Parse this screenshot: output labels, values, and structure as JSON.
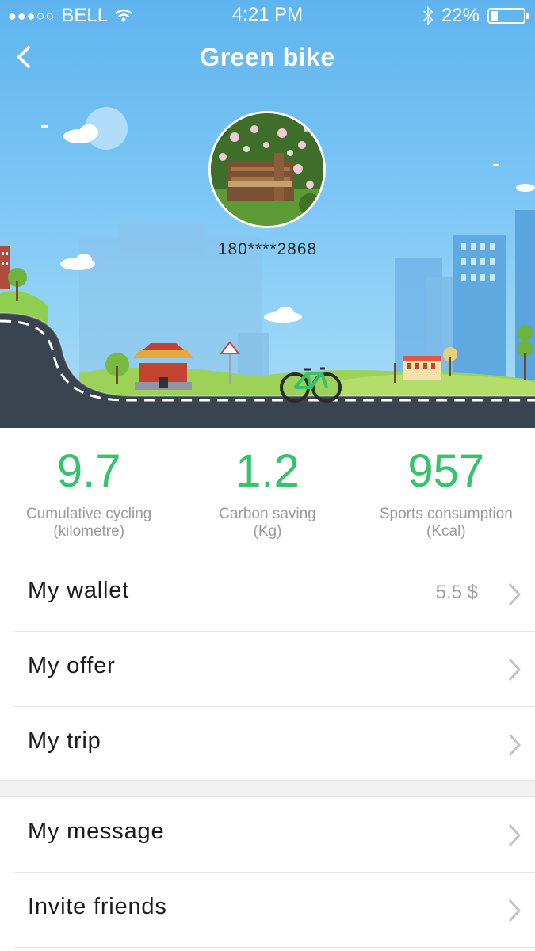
{
  "status_bar": {
    "carrier": "BELL",
    "signal_dots": "●●●○○",
    "time": "4:21 PM",
    "battery": "22%",
    "battery_level": 0.22
  },
  "header": {
    "title": "Green bike"
  },
  "profile": {
    "phone": "180****2868"
  },
  "stats": [
    {
      "value": "9.7",
      "label": "Cumulative cycling",
      "unit": "(kilometre)"
    },
    {
      "value": "1.2",
      "label": "Carbon saving",
      "unit": "(Kg)"
    },
    {
      "value": "957",
      "label": "Sports consumption",
      "unit": "(Kcal)"
    }
  ],
  "menu_group_1": [
    {
      "label": "My wallet",
      "value": "5.5 $"
    },
    {
      "label": "My offer"
    },
    {
      "label": "My trip"
    }
  ],
  "menu_group_2": [
    {
      "label": "My message"
    },
    {
      "label": "Invite friends"
    }
  ],
  "colors": {
    "accent_green": "#35c46b",
    "sky_top": "#5fb4ef",
    "road": "#3a4350"
  }
}
